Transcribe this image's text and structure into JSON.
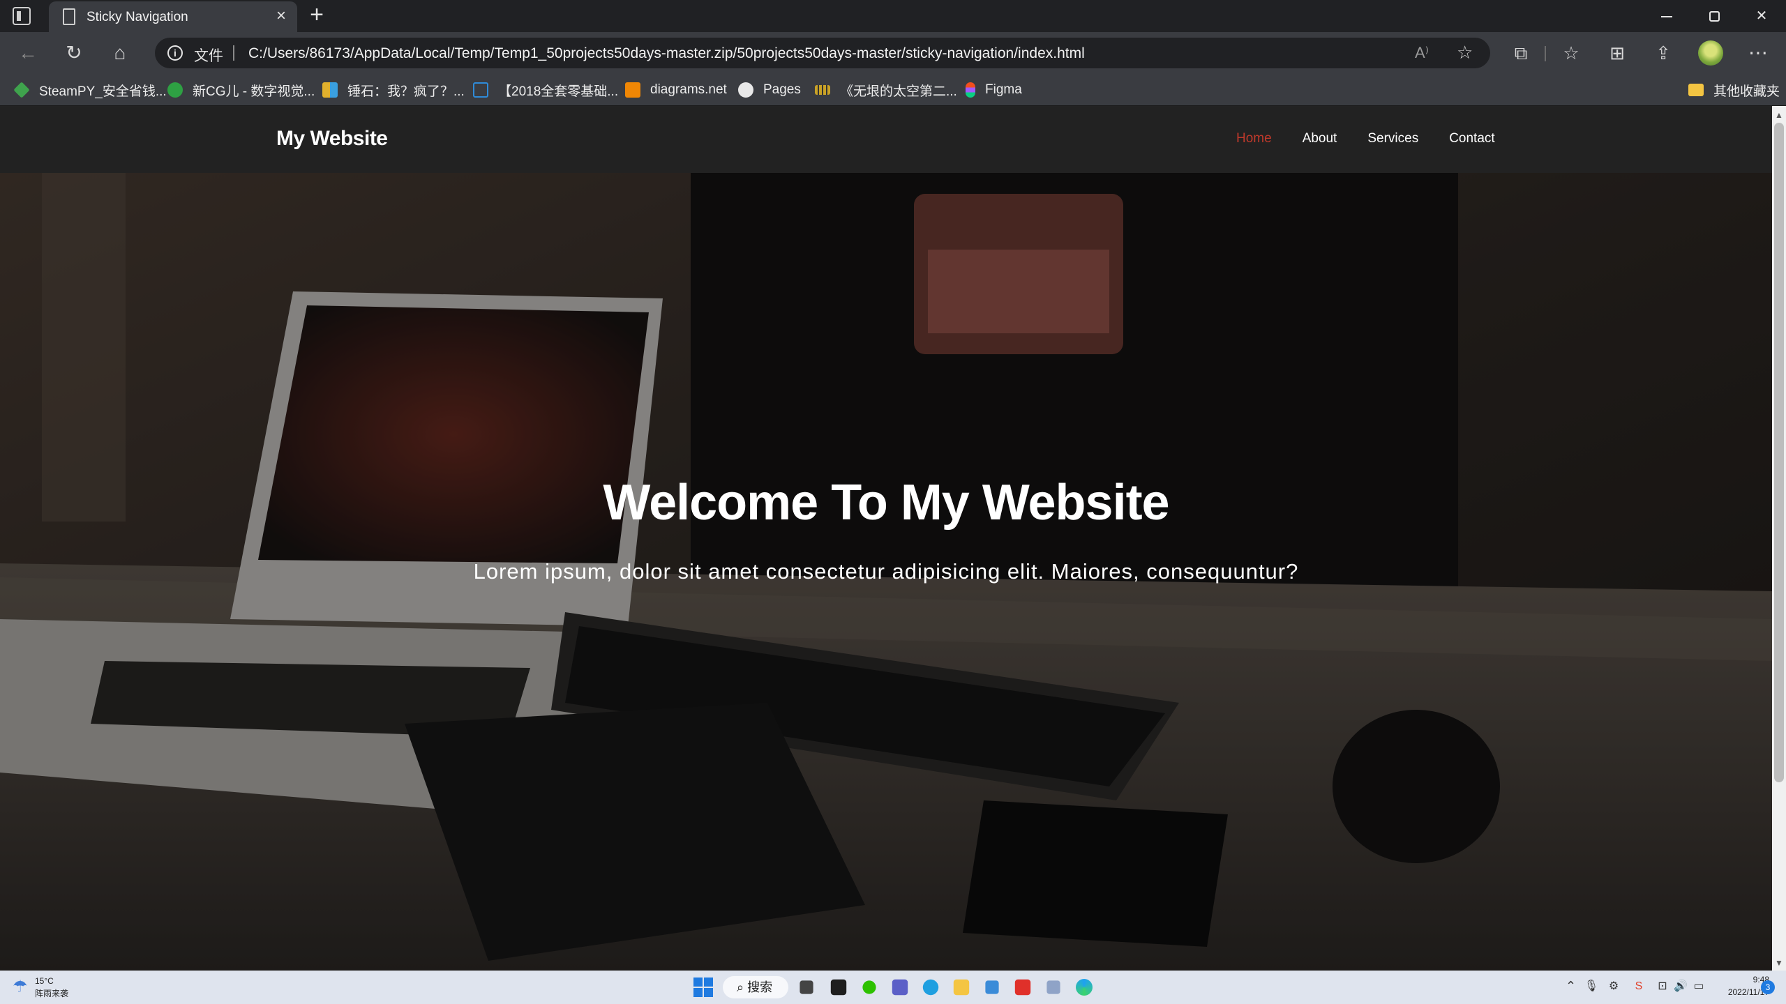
{
  "browser": {
    "tab": {
      "title": "Sticky Navigation"
    },
    "address": {
      "file_label": "文件",
      "url": "C:/Users/86173/AppData/Local/Temp/Temp1_50projects50days-master.zip/50projects50days-master/sticky-navigation/index.html"
    },
    "bookmarks": [
      {
        "label": "SteamPY_安全省钱...",
        "icon": "steampy-icon",
        "color": "#3fa34d"
      },
      {
        "label": "新CG儿 - 数字视觉...",
        "icon": "cg-icon",
        "color": "#2ea043"
      },
      {
        "label": "锤石：我？疯了？...",
        "icon": "bilibili-grid-icon",
        "color": "#e0b02d"
      },
      {
        "label": "【2018全套零基础...",
        "icon": "bilibili-icon",
        "color": "#2f8bd8"
      },
      {
        "label": "diagrams.net",
        "icon": "diagrams-icon",
        "color": "#f08705"
      },
      {
        "label": "Pages",
        "icon": "github-icon",
        "color": "#e8e8e8"
      },
      {
        "label": "《无垠的太空第二...",
        "icon": "film-icon",
        "color": "#c9a227"
      },
      {
        "label": "Figma",
        "icon": "figma-icon",
        "color": "#a259ff"
      }
    ],
    "other_bookmarks": {
      "label": "其他收藏夹",
      "icon": "folder-icon",
      "color": "#f4c542"
    }
  },
  "site": {
    "logo": "My Website",
    "nav": [
      {
        "label": "Home",
        "active": true
      },
      {
        "label": "About",
        "active": false
      },
      {
        "label": "Services",
        "active": false
      },
      {
        "label": "Contact",
        "active": false
      }
    ],
    "hero": {
      "title": "Welcome To My Website",
      "subtitle": "Lorem ipsum, dolor sit amet consectetur adipisicing elit. Maiores, consequuntur?"
    },
    "accent_color": "#c0392b"
  },
  "taskbar": {
    "weather": {
      "temp": "15°C",
      "desc": "阵雨来袭"
    },
    "search_label": "搜索",
    "clock": {
      "time": "9:48",
      "date": "2022/11/17"
    },
    "notifications": "3"
  }
}
